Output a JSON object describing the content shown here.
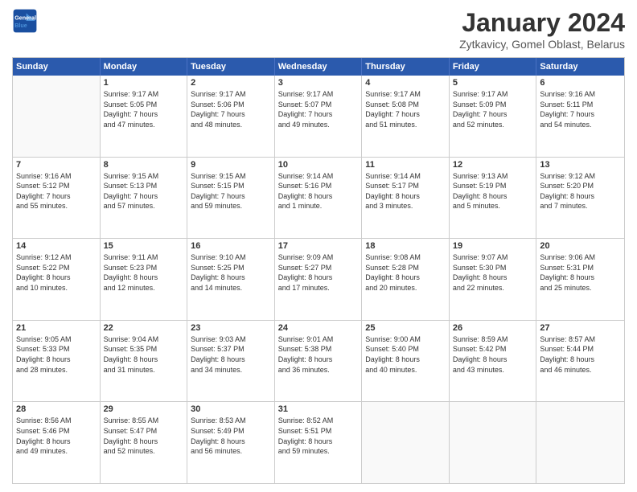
{
  "header": {
    "logo_line1": "General",
    "logo_line2": "Blue",
    "title": "January 2024",
    "subtitle": "Zytkavicy, Gomel Oblast, Belarus"
  },
  "day_headers": [
    "Sunday",
    "Monday",
    "Tuesday",
    "Wednesday",
    "Thursday",
    "Friday",
    "Saturday"
  ],
  "weeks": [
    [
      {
        "day": "",
        "info": ""
      },
      {
        "day": "1",
        "info": "Sunrise: 9:17 AM\nSunset: 5:05 PM\nDaylight: 7 hours\nand 47 minutes."
      },
      {
        "day": "2",
        "info": "Sunrise: 9:17 AM\nSunset: 5:06 PM\nDaylight: 7 hours\nand 48 minutes."
      },
      {
        "day": "3",
        "info": "Sunrise: 9:17 AM\nSunset: 5:07 PM\nDaylight: 7 hours\nand 49 minutes."
      },
      {
        "day": "4",
        "info": "Sunrise: 9:17 AM\nSunset: 5:08 PM\nDaylight: 7 hours\nand 51 minutes."
      },
      {
        "day": "5",
        "info": "Sunrise: 9:17 AM\nSunset: 5:09 PM\nDaylight: 7 hours\nand 52 minutes."
      },
      {
        "day": "6",
        "info": "Sunrise: 9:16 AM\nSunset: 5:11 PM\nDaylight: 7 hours\nand 54 minutes."
      }
    ],
    [
      {
        "day": "7",
        "info": "Sunrise: 9:16 AM\nSunset: 5:12 PM\nDaylight: 7 hours\nand 55 minutes."
      },
      {
        "day": "8",
        "info": "Sunrise: 9:15 AM\nSunset: 5:13 PM\nDaylight: 7 hours\nand 57 minutes."
      },
      {
        "day": "9",
        "info": "Sunrise: 9:15 AM\nSunset: 5:15 PM\nDaylight: 7 hours\nand 59 minutes."
      },
      {
        "day": "10",
        "info": "Sunrise: 9:14 AM\nSunset: 5:16 PM\nDaylight: 8 hours\nand 1 minute."
      },
      {
        "day": "11",
        "info": "Sunrise: 9:14 AM\nSunset: 5:17 PM\nDaylight: 8 hours\nand 3 minutes."
      },
      {
        "day": "12",
        "info": "Sunrise: 9:13 AM\nSunset: 5:19 PM\nDaylight: 8 hours\nand 5 minutes."
      },
      {
        "day": "13",
        "info": "Sunrise: 9:12 AM\nSunset: 5:20 PM\nDaylight: 8 hours\nand 7 minutes."
      }
    ],
    [
      {
        "day": "14",
        "info": "Sunrise: 9:12 AM\nSunset: 5:22 PM\nDaylight: 8 hours\nand 10 minutes."
      },
      {
        "day": "15",
        "info": "Sunrise: 9:11 AM\nSunset: 5:23 PM\nDaylight: 8 hours\nand 12 minutes."
      },
      {
        "day": "16",
        "info": "Sunrise: 9:10 AM\nSunset: 5:25 PM\nDaylight: 8 hours\nand 14 minutes."
      },
      {
        "day": "17",
        "info": "Sunrise: 9:09 AM\nSunset: 5:27 PM\nDaylight: 8 hours\nand 17 minutes."
      },
      {
        "day": "18",
        "info": "Sunrise: 9:08 AM\nSunset: 5:28 PM\nDaylight: 8 hours\nand 20 minutes."
      },
      {
        "day": "19",
        "info": "Sunrise: 9:07 AM\nSunset: 5:30 PM\nDaylight: 8 hours\nand 22 minutes."
      },
      {
        "day": "20",
        "info": "Sunrise: 9:06 AM\nSunset: 5:31 PM\nDaylight: 8 hours\nand 25 minutes."
      }
    ],
    [
      {
        "day": "21",
        "info": "Sunrise: 9:05 AM\nSunset: 5:33 PM\nDaylight: 8 hours\nand 28 minutes."
      },
      {
        "day": "22",
        "info": "Sunrise: 9:04 AM\nSunset: 5:35 PM\nDaylight: 8 hours\nand 31 minutes."
      },
      {
        "day": "23",
        "info": "Sunrise: 9:03 AM\nSunset: 5:37 PM\nDaylight: 8 hours\nand 34 minutes."
      },
      {
        "day": "24",
        "info": "Sunrise: 9:01 AM\nSunset: 5:38 PM\nDaylight: 8 hours\nand 36 minutes."
      },
      {
        "day": "25",
        "info": "Sunrise: 9:00 AM\nSunset: 5:40 PM\nDaylight: 8 hours\nand 40 minutes."
      },
      {
        "day": "26",
        "info": "Sunrise: 8:59 AM\nSunset: 5:42 PM\nDaylight: 8 hours\nand 43 minutes."
      },
      {
        "day": "27",
        "info": "Sunrise: 8:57 AM\nSunset: 5:44 PM\nDaylight: 8 hours\nand 46 minutes."
      }
    ],
    [
      {
        "day": "28",
        "info": "Sunrise: 8:56 AM\nSunset: 5:46 PM\nDaylight: 8 hours\nand 49 minutes."
      },
      {
        "day": "29",
        "info": "Sunrise: 8:55 AM\nSunset: 5:47 PM\nDaylight: 8 hours\nand 52 minutes."
      },
      {
        "day": "30",
        "info": "Sunrise: 8:53 AM\nSunset: 5:49 PM\nDaylight: 8 hours\nand 56 minutes."
      },
      {
        "day": "31",
        "info": "Sunrise: 8:52 AM\nSunset: 5:51 PM\nDaylight: 8 hours\nand 59 minutes."
      },
      {
        "day": "",
        "info": ""
      },
      {
        "day": "",
        "info": ""
      },
      {
        "day": "",
        "info": ""
      }
    ]
  ]
}
